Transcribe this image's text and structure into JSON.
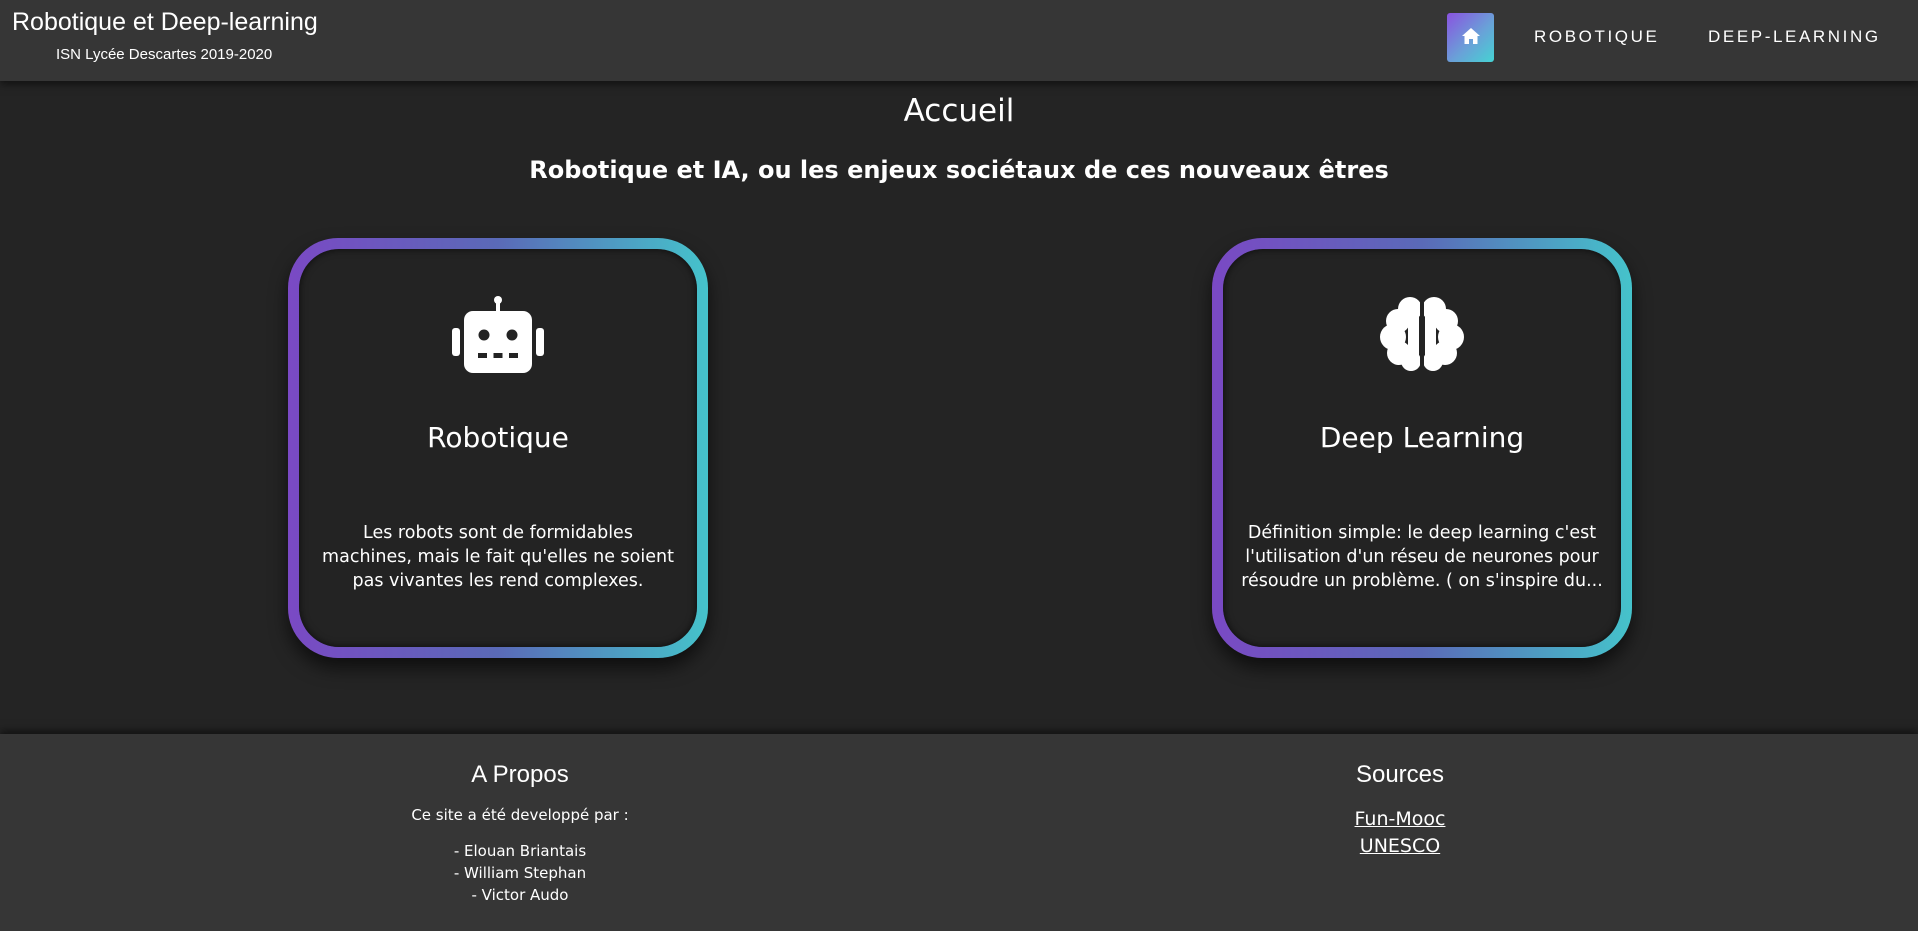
{
  "header": {
    "title": "Robotique et Deep-learning",
    "subtitle": "ISN Lycée Descartes 2019-2020",
    "nav": {
      "home_icon": "home-icon",
      "robotique": "ROBOTIQUE",
      "deep_learning": "DEEP-LEARNING"
    }
  },
  "main": {
    "title": "Accueil",
    "subtitle": "Robotique et IA, ou les enjeux sociétaux de ces nouveaux êtres",
    "cards": [
      {
        "icon": "robot-icon",
        "title": "Robotique",
        "text": "Les robots sont de formidables machines, mais le fait qu'elles ne soient pas vivantes les rend complexes."
      },
      {
        "icon": "brain-icon",
        "title": "Deep Learning",
        "text": "Définition simple: le deep learning c'est l'utilisation d'un réseu de neurones pour résoudre un problème. ( on s'inspire du..."
      }
    ]
  },
  "footer": {
    "about": {
      "heading": "A Propos",
      "intro": "Ce site a été developpé par :",
      "names": [
        "- Elouan Briantais",
        "- William Stephan",
        "- Victor Audo"
      ]
    },
    "sources": {
      "heading": "Sources",
      "links": [
        "Fun-Mooc",
        "UNESCO"
      ]
    }
  },
  "colors": {
    "accent_purple": "#7a49c4",
    "accent_teal": "#45c3cb",
    "background": "#242424",
    "bar": "#363636"
  }
}
